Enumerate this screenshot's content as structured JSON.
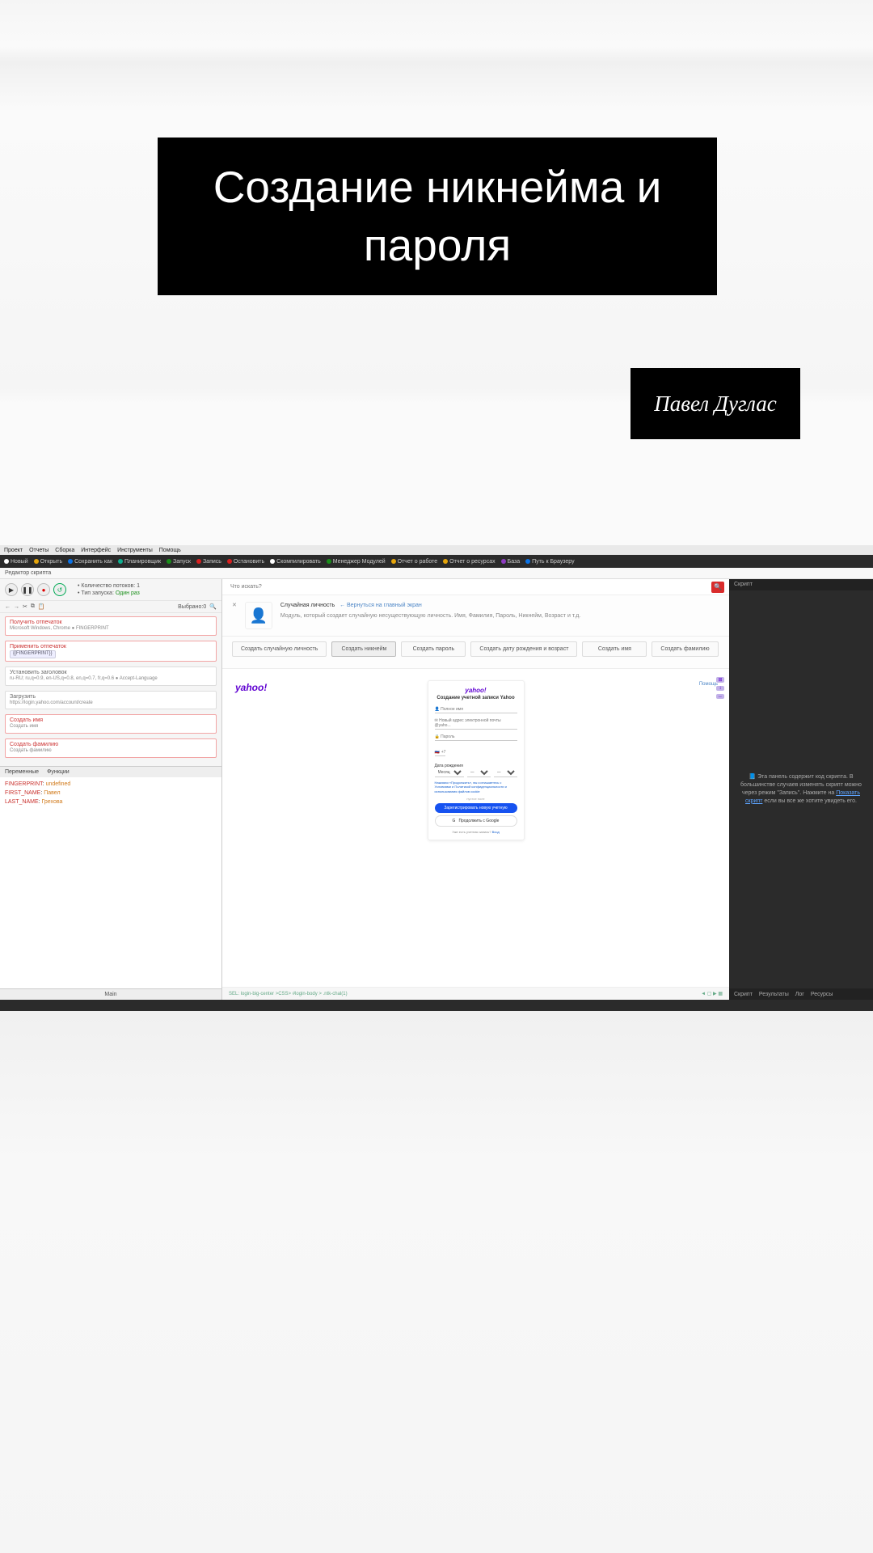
{
  "overlay": {
    "title": "Создание никнейма и пароля",
    "author": "Павел Дуглас"
  },
  "menubar": [
    "Проект",
    "Отчеты",
    "Сборка",
    "Интерфейс",
    "Инструменты",
    "Помощь"
  ],
  "toolbar": [
    {
      "label": "Новый",
      "color": "white"
    },
    {
      "label": "Открыть",
      "color": "yellow"
    },
    {
      "label": "Сохранить как",
      "color": "blue"
    },
    {
      "label": "Планировщик",
      "color": "teal"
    },
    {
      "label": "Запуск",
      "color": "green"
    },
    {
      "label": "Запись",
      "color": "red"
    },
    {
      "label": "Остановить",
      "color": "red"
    },
    {
      "label": "Скомпилировать",
      "color": "white"
    },
    {
      "label": "Менеджер Модулей",
      "color": "green"
    },
    {
      "label": "Отчет о работе",
      "color": "yellow"
    },
    {
      "label": "Отчет о ресурсах",
      "color": "yellow"
    },
    {
      "label": "База",
      "color": "purple"
    },
    {
      "label": "Путь к Браузеру",
      "color": "blue"
    }
  ],
  "sub_header": "Редактор скрипта",
  "play_meta": {
    "line1_label": "Количество потоков:",
    "line1_value": "1",
    "line2_label": "Тип запуска:",
    "line2_value": "Один раз"
  },
  "mini_toolbar": {
    "selected_label": "Выбрано:",
    "selected_value": "0"
  },
  "steps": [
    {
      "title": "Получить отпечаток",
      "body": "Microsoft Windows, Chrome ● FINGERPRINT",
      "cls": ""
    },
    {
      "title": "Применить отпечаток",
      "body": "{{FINGERPRINT}}",
      "cls": ""
    },
    {
      "title": "Установить заголовок",
      "body": "ru-RU; ru,q=0.9, en-US,q=0.8, en,q=0.7, fr,q=0.6 ● Accept-Language",
      "cls": "gray"
    },
    {
      "title": "Загрузить",
      "body": "https://login.yahoo.com/account/create",
      "cls": "gray"
    },
    {
      "title": "Создать имя",
      "body": "Создать имя",
      "cls": ""
    },
    {
      "title": "Создать фамилию",
      "body": "Создать фамилию",
      "cls": ""
    }
  ],
  "vars_tabs": [
    "Переменные",
    "Функции"
  ],
  "vars": [
    {
      "k": "FINGERPRINT",
      "v": "undefined"
    },
    {
      "k": "FIRST_NAME",
      "v": "Павел"
    },
    {
      "k": "LAST_NAME",
      "v": "Грехова"
    }
  ],
  "left_footer": "Main",
  "center": {
    "search_placeholder": "Что искать?",
    "crumb_prefix": "Случайная личность",
    "crumb_link_icon": "✕",
    "crumb_link": "← Вернуться на главный экран",
    "module_desc": "Модуль, который создает случайную несуществующую личность. Имя, Фамилия, Пароль, Никнейм, Возраст и т.д.",
    "buttons": [
      "Создать случайную личность",
      "Создать никнейм",
      "Создать пароль",
      "Создать дату рождения и возраст",
      "Создать имя",
      "Создать фамилию"
    ],
    "right_link": "Помощь",
    "footer_left": "SEL: login-big-center   >CSS> #login-body > .ntk-chal(1)",
    "footer_right": [
      "◄",
      "▢",
      "▶",
      "▦"
    ]
  },
  "yahoo": {
    "logo": "yahoo!",
    "title": "Создание учетной записи Yahoo",
    "field_fullname": "Полное имя",
    "field_email": "Новый адрес электронной почты @yaho...",
    "field_password": "Пароль",
    "field_phone_prefix": "+7",
    "date_label": "Дата рождения",
    "date_month": "Месяц",
    "date_placeholder": "—",
    "tip": "Нажимая «Продолжить», вы соглашаетесь с Условиями и Политикой конфиденциальности и использования файлов cookie",
    "gray_note": "пустое поле",
    "cta": "Зарегистрировать новую учетную",
    "alt_icon": "G",
    "alt_label": "Продолжить с Google",
    "foot_text": "Уже есть учетная запись?",
    "foot_link": "Вход"
  },
  "right": {
    "header": "Скрипт",
    "hint_prefix": "Эта панель содержит код скрипта. В большинстве случаев изменять скрипт можно через режим \"Запись\". Нажмите на ",
    "hint_link": "Показать скрипт",
    "hint_suffix": " если вы все же хотите увидеть его.",
    "tabs": [
      "Скрипт",
      "Результаты",
      "Лог",
      "Ресурсы"
    ]
  }
}
